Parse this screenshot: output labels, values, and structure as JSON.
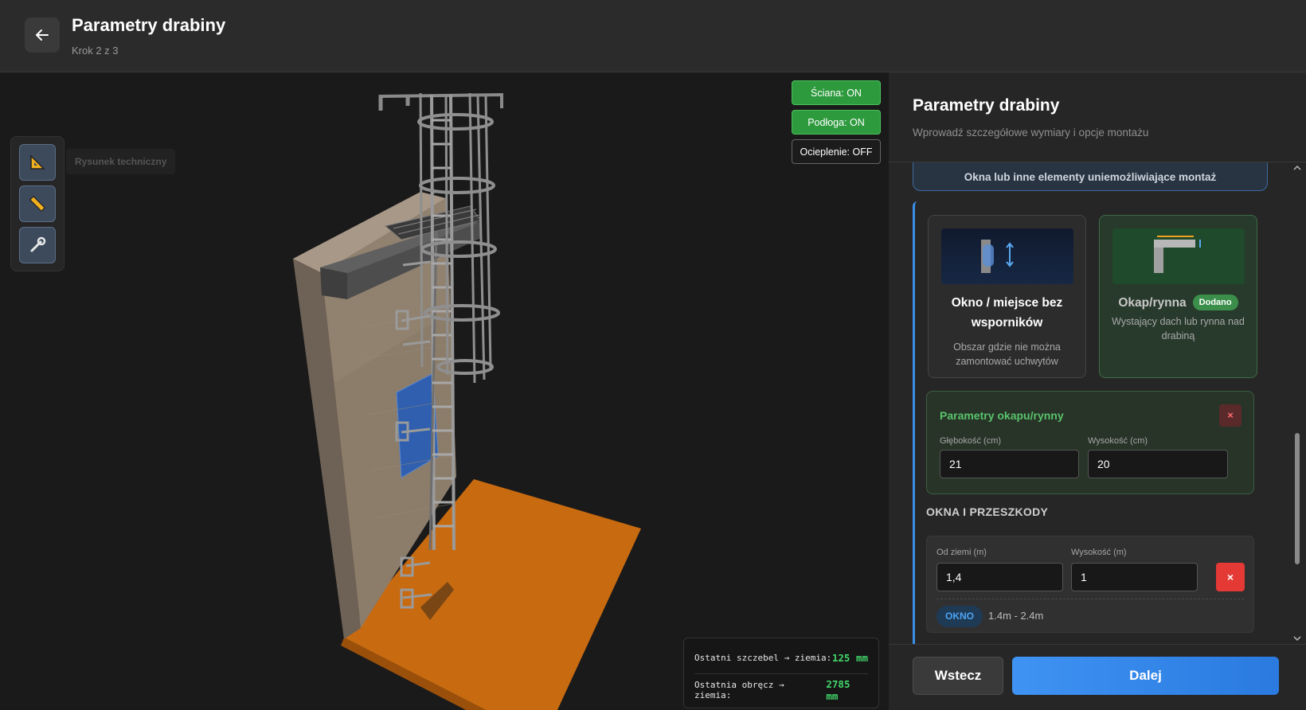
{
  "header": {
    "title": "Parametry drabiny",
    "step": "Krok 2 z 3"
  },
  "viewport": {
    "tech_drawing_label": "Rysunek techniczny",
    "toggles": {
      "wall": "Ściana: ON",
      "floor": "Podłoga: ON",
      "insulation": "Ocieplenie: OFF"
    },
    "measurements": {
      "last_rung_label": "Ostatni szczebel → ziemia:",
      "last_rung_value": "125 mm",
      "last_hoop_label": "Ostatnia obręcz → ziemia:",
      "last_hoop_value": "2785 mm"
    },
    "colors": {
      "floor": "#c86a10",
      "wall": "#8c7c6a",
      "window": "#2f5fae",
      "ladder": "#8a8a8a"
    },
    "tools": [
      "set-square-icon",
      "ruler-icon",
      "wrench-icon"
    ]
  },
  "panel": {
    "title": "Parametry drabiny",
    "subtitle": "Wprowadź szczegółowe wymiary i opcje montażu",
    "obstacles_banner": "Okna lub inne elementy uniemożliwiające montaż",
    "cards": {
      "window": {
        "name": "Okno / miejsce bez wsporników",
        "desc": "Obszar gdzie nie można zamontować uchwytów"
      },
      "eave": {
        "name": "Okap/rynna",
        "badge": "Dodano",
        "desc": "Wystający dach lub rynna nad drabiną"
      }
    },
    "eave_params": {
      "title": "Parametry okapu/rynny",
      "remove": "×",
      "depth_label": "Głębokość (cm)",
      "depth_value": "21",
      "height_label": "Wysokość (cm)",
      "height_value": "20"
    },
    "windows_section": {
      "title": "OKNA I PRZESZKODY",
      "from_ground_label": "Od ziemi (m)",
      "from_ground_value": "1,4",
      "height_label": "Wysokość (m)",
      "height_value": "1",
      "remove": "×",
      "type_badge": "OKNO",
      "range": "1.4m - 2.4m"
    },
    "footer": {
      "back": "Wstecz",
      "next": "Dalej"
    },
    "accent": "#3a8ee6",
    "success": "#3b8f4a",
    "danger": "#e53935"
  }
}
